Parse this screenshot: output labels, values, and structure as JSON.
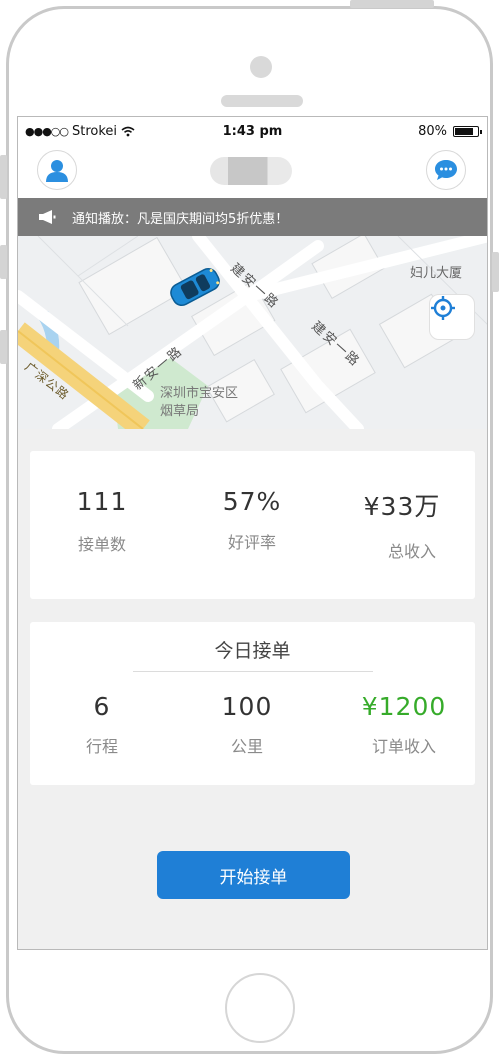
{
  "status_bar": {
    "carrier": "Strokei",
    "time": "1:43 pm",
    "battery": "80%",
    "battery_level": 0.8
  },
  "nav": {
    "avatar_icon": "user-avatar-icon",
    "message_icon": "chat-bubble-icon"
  },
  "notice": {
    "icon": "megaphone-icon",
    "text": "通知播放：凡是国庆期间均5折优惠！"
  },
  "map": {
    "labels": {
      "road_top": "建安一路",
      "road_right": "建安一路",
      "road_left": "新安一路",
      "highway": "广深公路",
      "district_1": "深圳市宝安区",
      "district_2": "烟草局",
      "place": "妇儿大厦"
    },
    "car_icon": "car-icon",
    "locate_icon": "crosshair-icon"
  },
  "stats": [
    {
      "value": "111",
      "label": "接单数"
    },
    {
      "value": "57%",
      "label": "好评率"
    },
    {
      "value": "¥33万",
      "label": "总收入"
    }
  ],
  "today": {
    "title": "今日接单",
    "items": [
      {
        "value": "6",
        "label": "行程"
      },
      {
        "value": "100",
        "label": "公里"
      },
      {
        "value": "¥1200",
        "label": "订单收入"
      }
    ],
    "income_color": "#36ab2a"
  },
  "start_button": "开始接单",
  "colors": {
    "accent": "#1f7fd6",
    "notice_bg": "#7b7b7b",
    "income_green": "#36ab2a"
  }
}
